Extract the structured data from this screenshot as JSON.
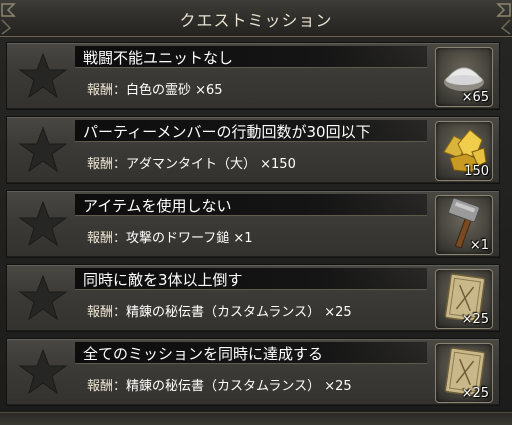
{
  "header": {
    "title": "クエストミッション"
  },
  "reward_label": "報酬：",
  "missions": [
    {
      "title": "戦闘不能ユニットなし",
      "reward": "白色の霊砂 ×65",
      "qty": "×65",
      "icon": "white-spirit-sand-icon"
    },
    {
      "title": "パーティーメンバーの行動回数が30回以下",
      "reward": "アダマンタイト（大） ×150",
      "qty": "150",
      "icon": "adamantite-large-icon"
    },
    {
      "title": "アイテムを使用しない",
      "reward": "攻撃のドワーフ鎚 ×1",
      "qty": "×1",
      "icon": "dwarf-hammer-icon"
    },
    {
      "title": "同時に敵を3体以上倒す",
      "reward": "精錬の秘伝書（カスタムランス） ×25",
      "qty": "×25",
      "icon": "secret-tome-icon"
    },
    {
      "title": "全てのミッションを同時に達成する",
      "reward": "精錬の秘伝書（カスタムランス） ×25",
      "qty": "×25",
      "icon": "secret-tome-icon"
    }
  ],
  "colors": {
    "star": "#2a2a28",
    "header_text": "#e8e2d0",
    "gold": "#d9b43a"
  }
}
